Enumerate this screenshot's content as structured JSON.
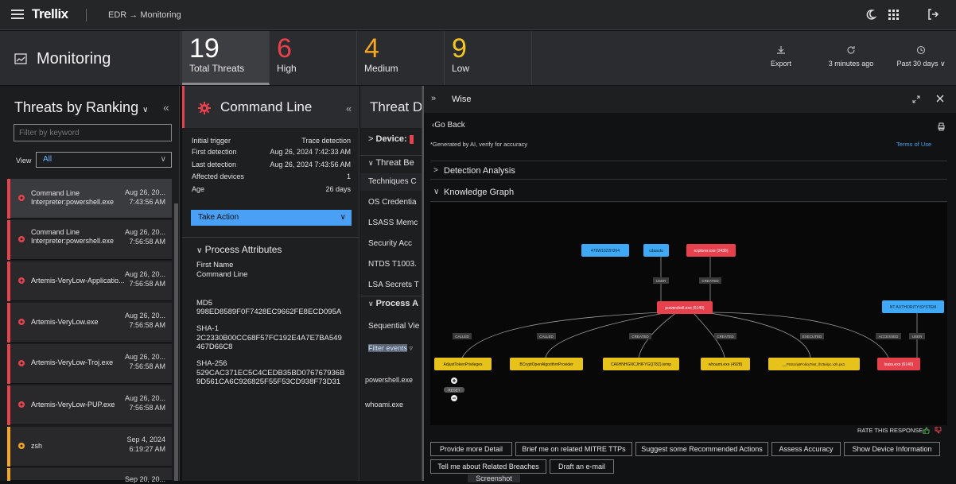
{
  "topbar": {
    "logo": "Trellix",
    "breadcrumb": "EDR → Monitoring"
  },
  "monitoring": {
    "title": "Monitoring"
  },
  "stats": [
    {
      "value": "19",
      "label": "Total Threats",
      "color": "#ffffff"
    },
    {
      "value": "6",
      "label": "High",
      "color": "#e8414e"
    },
    {
      "value": "4",
      "label": "Medium",
      "color": "#f5a623"
    },
    {
      "value": "9",
      "label": "Low",
      "color": "#f5c623"
    }
  ],
  "header_actions": {
    "export": "Export",
    "refresh": "3 minutes ago",
    "range": "Past 30 days ∨"
  },
  "left_panel": {
    "title": "Threats by Ranking",
    "filter_placeholder": "Filter by keyword",
    "view_label": "View",
    "view_value": "All",
    "threats": [
      {
        "name1": "Command Line",
        "name2": "Interpreter:powershell.exe",
        "date": "Aug 26, 20...",
        "time": "7:43:56 AM",
        "color": "#e8414e"
      },
      {
        "name1": "Command Line",
        "name2": "Interpreter:powershell.exe",
        "date": "Aug 26, 20...",
        "time": "7:56:58 AM",
        "color": "#e8414e"
      },
      {
        "name1": "Artemis-VeryLow-Applicatio...",
        "name2": "",
        "date": "Aug 26, 20...",
        "time": "7:56:58 AM",
        "color": "#e8414e"
      },
      {
        "name1": "Artemis-VeryLow.exe",
        "name2": "",
        "date": "Aug 26, 20...",
        "time": "7:56:58 AM",
        "color": "#e8414e"
      },
      {
        "name1": "Artemis-VeryLow-Troj.exe",
        "name2": "",
        "date": "Aug 26, 20...",
        "time": "7:56:58 AM",
        "color": "#e8414e"
      },
      {
        "name1": "Artemis-VeryLow-PUP.exe",
        "name2": "",
        "date": "Aug 26, 20...",
        "time": "7:56:58 AM",
        "color": "#e8414e"
      },
      {
        "name1": "zsh",
        "name2": "",
        "date": "Sep 4, 2024",
        "time": "6:19:27 AM",
        "color": "#f5a623"
      },
      {
        "name1": "",
        "name2": "",
        "date": "Sep 20, 20...",
        "time": "",
        "color": "#f5a623"
      }
    ]
  },
  "detail": {
    "title": "Command Line",
    "rows": [
      {
        "k": "Initial trigger",
        "v": "Trace detection"
      },
      {
        "k": "First detection",
        "v": "Aug 26, 2024 7:42:33 AM"
      },
      {
        "k": "Last detection",
        "v": "Aug 26, 2024 7:43:56 AM"
      },
      {
        "k": "Affected devices",
        "v": "1"
      },
      {
        "k": "Age",
        "v": "26 days"
      }
    ],
    "take_action": "Take Action",
    "process_attributes": "Process Attributes",
    "first_name_label": "First Name",
    "first_name_value": "Command Line",
    "md5_label": "MD5",
    "md5_value": "998ED8589F0F7428EC9662FE8ECD095A",
    "sha1_label": "SHA-1",
    "sha1_value1": "2C2330B00CC68F57FC192E4A7E7BA549",
    "sha1_value2": "467D66C8",
    "sha256_label": "SHA-256",
    "sha256_value1": "529CAC371EC5C4CEDB35BD076767936B",
    "sha256_value2": "9D561CA6C926825F55F53CD938F73D31"
  },
  "threat_panel": {
    "title": "Threat D",
    "device": "Device:",
    "behavior": "Threat Be",
    "techniques": "Techniques C",
    "items": [
      "OS Credentia",
      "LSASS Memc",
      "Security Acc",
      "NTDS T1003.",
      "LSA Secrets T"
    ],
    "process": "Process A",
    "sequential": "Sequential Vie",
    "filter_events": "Filter events",
    "proc1": "powershell.exe",
    "proc2": "whoami.exe"
  },
  "wise": {
    "title": "Wise",
    "go_back": "Go Back",
    "ai_warning": "*Generated by AI, verify for accuracy",
    "terms": "Terms of Use",
    "detection_analysis": "Detection Analysis",
    "knowledge_graph": "Knowledge Graph",
    "rate": "RATE THIS RESPONSE",
    "graph": {
      "top_nodes": [
        "479W1022H264",
        "cdaauto",
        "explorer.exe (2436)"
      ],
      "center": "powershell.exe (6140)",
      "system": "NT AUTHORITY\\SYSTEM",
      "edge_user": "USER",
      "edge_created": "CREATED",
      "bottom_edges": [
        "CALLED",
        "CALLED",
        "CREATED",
        "CREATED",
        "EXECUTED",
        "ACCESSED",
        "USER"
      ],
      "bottom_nodes": [
        "AdjustTokenPrivileges",
        "BCryptOpenAlgorithmProvider",
        "CA6HNHGNCJHIFYGQ78Z).temp",
        "whoami.exe (4928)",
        "__PSScriptPolicyTest_lhz5xlpc.x2h.ps1",
        "lsass.exe (6140)"
      ],
      "reset": "RESET"
    },
    "actions": [
      "Provide more Detail",
      "Brief me on related MITRE TTPs",
      "Suggest some Recommended Actions",
      "Assess Accuracy",
      "Show Device Information",
      "Tell me about Related Breaches",
      "Draft an e-mail"
    ],
    "screenshot": "Screenshot"
  },
  "colors": {
    "red": "#e8414e",
    "orange": "#f5a623",
    "blue": "#4aa0f5",
    "node_blue": "#3fa9f5",
    "node_yellow": "#e6c21a"
  }
}
